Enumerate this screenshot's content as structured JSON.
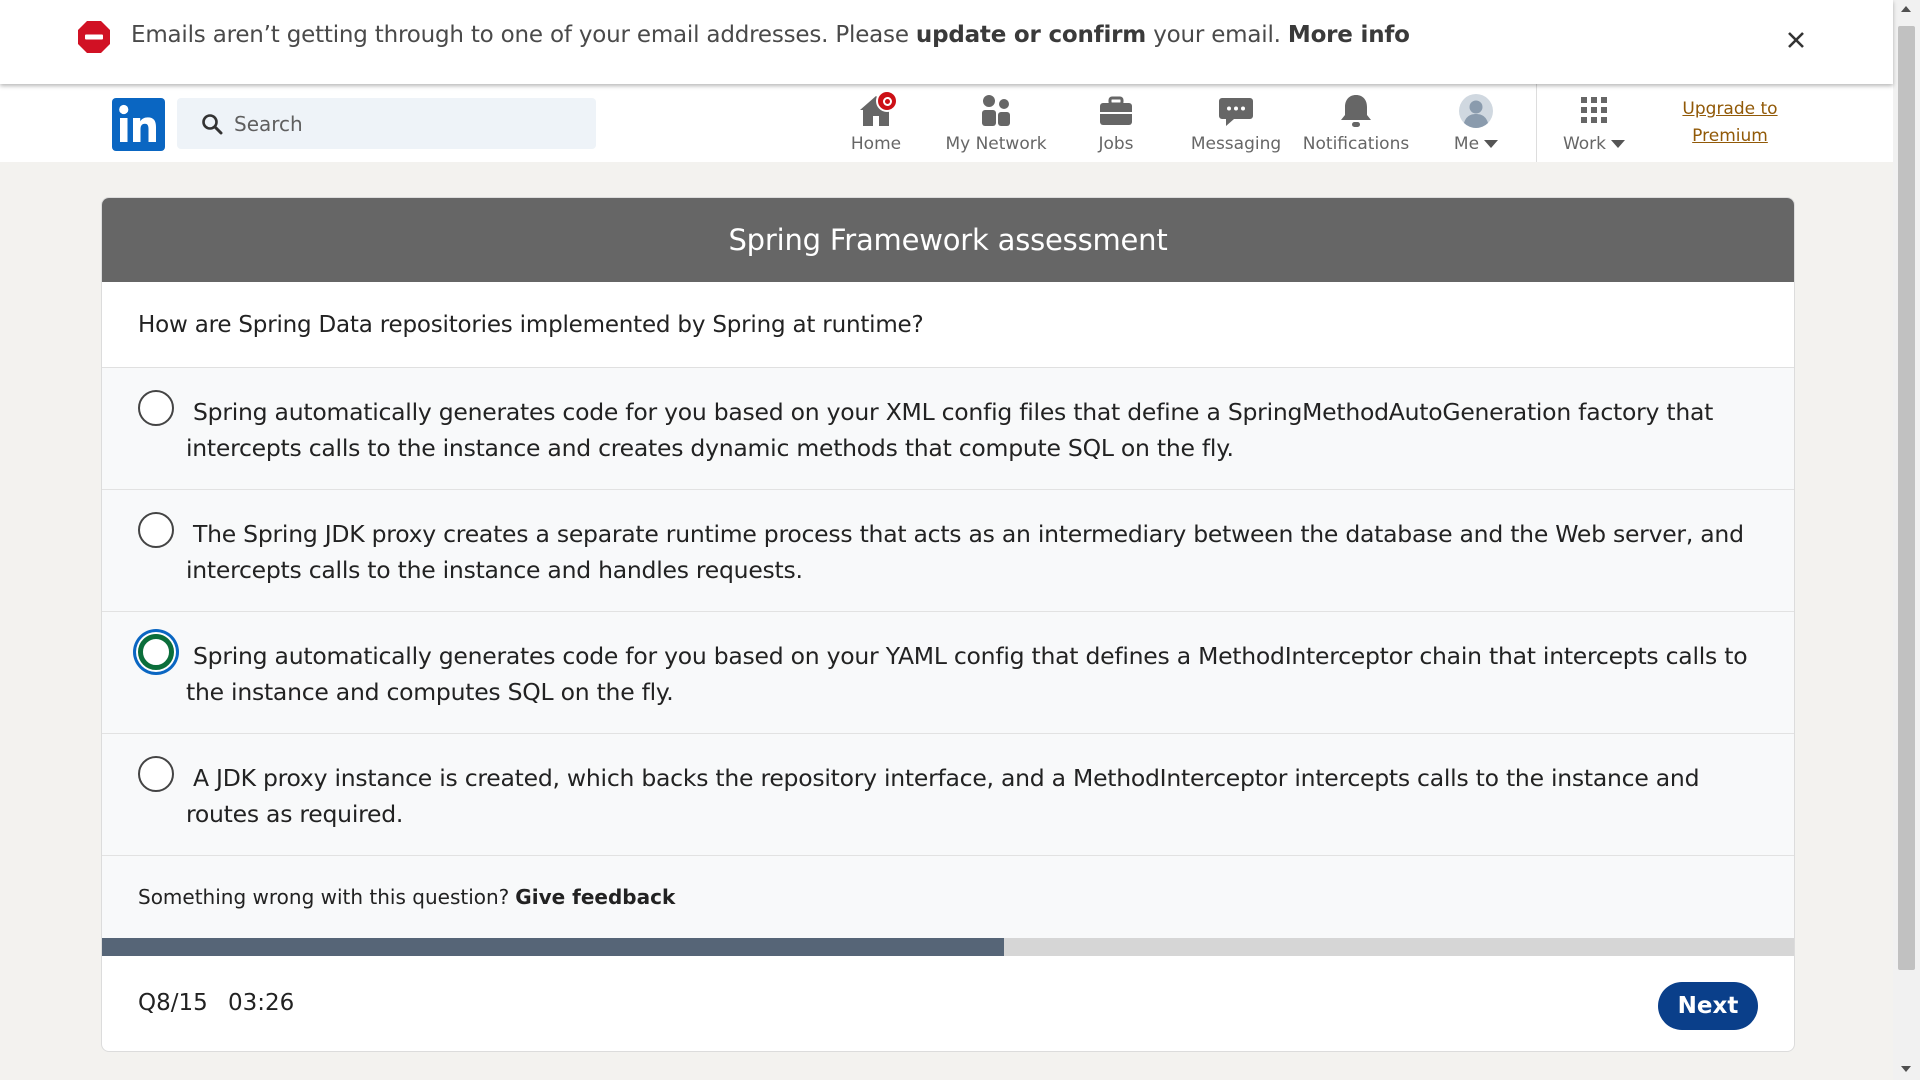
{
  "alert": {
    "text_pre": "Emails aren’t getting through to one of your email addresses. Please ",
    "link_update": "update or confirm",
    "text_mid": " your email. ",
    "link_more": "More info",
    "icon": "stop-icon",
    "close_icon": "close-icon"
  },
  "nav": {
    "search_placeholder": "Search",
    "items": [
      {
        "label": "Home",
        "icon": "home-icon"
      },
      {
        "label": "My Network",
        "icon": "network-icon"
      },
      {
        "label": "Jobs",
        "icon": "briefcase-icon"
      },
      {
        "label": "Messaging",
        "icon": "chat-icon"
      },
      {
        "label": "Notifications",
        "icon": "bell-icon"
      },
      {
        "label": "Me",
        "icon": "avatar"
      },
      {
        "label": "Work",
        "icon": "grid-icon"
      }
    ],
    "premium_line1": "Upgrade to",
    "premium_line2": "Premium"
  },
  "assessment": {
    "title": "Spring Framework assessment",
    "question": "How are Spring Data repositories implemented by Spring at runtime?",
    "options": [
      {
        "text": "Spring automatically generates code for you based on your XML config files that define a SpringMethodAutoGeneration factory that intercepts calls to the instance and creates dynamic methods that compute SQL on the fly.",
        "selected": false
      },
      {
        "text": "The Spring JDK proxy creates a separate runtime process that acts as an intermediary between the database and the Web server, and intercepts calls to the instance and handles requests.",
        "selected": false
      },
      {
        "text": "Spring automatically generates code for you based on your YAML config that defines a MethodInterceptor chain that intercepts calls to the instance and computes SQL on the fly.",
        "selected": true
      },
      {
        "text": "A JDK proxy instance is created, which backs the repository interface, and a MethodInterceptor intercepts calls to the instance and routes as required.",
        "selected": false
      }
    ],
    "feedback_prompt": "Something wrong with this question?",
    "feedback_link": "Give feedback",
    "progress_fraction": 0.533,
    "question_counter": "Q8/15",
    "timer": "03:26",
    "next_label": "Next"
  },
  "colors": {
    "linkedin_blue": "#0a66c2",
    "header_gray": "#666666",
    "selected_green": "#0b6e3b",
    "next_button": "#0a3f8a",
    "premium_gold": "#915907",
    "badge_red": "#cc1016"
  }
}
